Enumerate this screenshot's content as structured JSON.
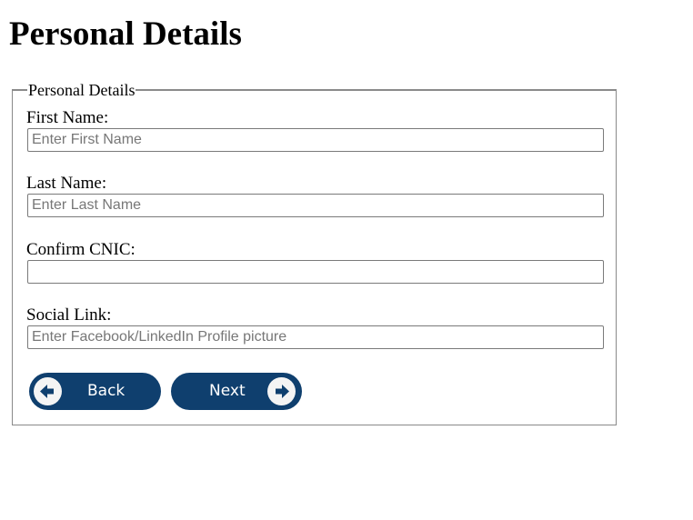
{
  "page": {
    "title": "Personal Details"
  },
  "form": {
    "legend": "Personal Details",
    "fields": [
      {
        "label": "First Name:",
        "placeholder": "Enter First Name",
        "value": ""
      },
      {
        "label": "Last Name:",
        "placeholder": "Enter Last Name",
        "value": ""
      },
      {
        "label": "Confirm CNIC:",
        "placeholder": "",
        "value": ""
      },
      {
        "label": "Social Link:",
        "placeholder": "Enter Facebook/LinkedIn Profile picture",
        "value": ""
      }
    ]
  },
  "buttons": {
    "back_label": "Back",
    "back_icon": "arrow-left-icon",
    "next_label": "Next",
    "next_icon": "arrow-right-icon"
  },
  "colors": {
    "button_background": "#0f3f6e",
    "button_text": "#ffffff",
    "icon_circle": "#f4f4f4"
  }
}
